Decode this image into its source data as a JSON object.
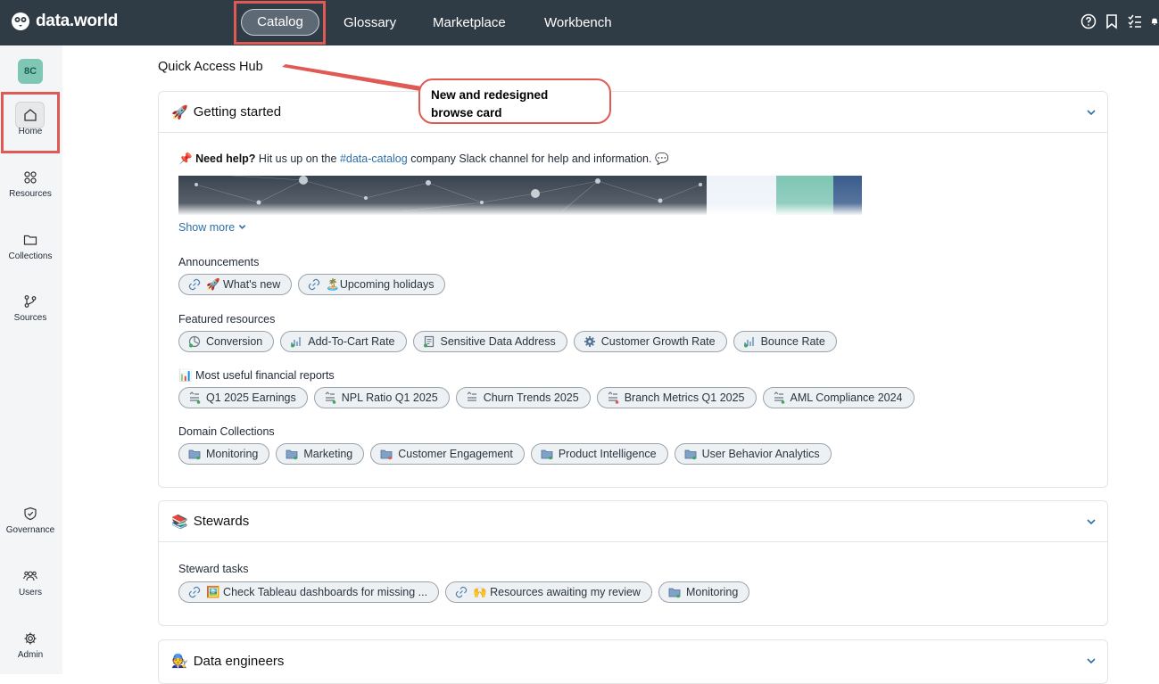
{
  "app": {
    "logo_text": "data.world"
  },
  "topnav": {
    "items": [
      "Catalog",
      "Glossary",
      "Marketplace",
      "Workbench"
    ],
    "active": "Catalog"
  },
  "sidebar": {
    "avatar": "8C",
    "items": [
      {
        "label": "Home",
        "icon": "home-icon"
      },
      {
        "label": "Resources",
        "icon": "resources-icon"
      },
      {
        "label": "Collections",
        "icon": "folder-icon"
      },
      {
        "label": "Sources",
        "icon": "branch-icon"
      },
      {
        "label": "Governance",
        "icon": "shield-icon"
      },
      {
        "label": "Users",
        "icon": "users-icon"
      },
      {
        "label": "Admin",
        "icon": "gear-icon"
      }
    ]
  },
  "main": {
    "hub_title": "Quick Access Hub",
    "callout": {
      "line1": "New and redesigned",
      "line2": "browse card"
    },
    "getting_started": {
      "emoji": "🚀",
      "title": "Getting started",
      "help_emoji": "📌",
      "help_bold": "Need help?",
      "help_pre": " Hit us up on the ",
      "help_link": "#data-catalog",
      "help_post": " company Slack channel for help and information. 💬",
      "show_more": "Show more",
      "announcements_label": "Announcements",
      "announcements": [
        "🚀 What's new",
        "🏝️Upcoming holidays"
      ],
      "featured_label": "Featured resources",
      "featured": [
        "Conversion",
        "Add-To-Cart Rate",
        "Sensitive Data Address",
        "Customer Growth Rate",
        "Bounce Rate"
      ],
      "reports_label": "📊 Most useful financial reports",
      "reports": [
        "Q1 2025 Earnings",
        "NPL Ratio Q1 2025",
        "Churn Trends 2025",
        "Branch Metrics Q1 2025",
        "AML Compliance 2024"
      ],
      "domains_label": "Domain Collections",
      "domains": [
        "Monitoring",
        "Marketing",
        "Customer Engagement",
        "Product Intelligence",
        "User Behavior Analytics"
      ]
    },
    "stewards": {
      "emoji": "📚",
      "title": "Stewards",
      "tasks_label": "Steward tasks",
      "tasks": [
        "🖼️ Check Tableau dashboards for missing ...",
        "🙌 Resources awaiting my review",
        "Monitoring"
      ]
    },
    "data_engineers": {
      "emoji": "🧑‍🔧",
      "title": "Data engineers"
    }
  },
  "colors": {
    "topbar": "#2f3b45",
    "accent_red": "#e05a55",
    "link": "#2e6fa6",
    "chip_bg": "#eef1f4"
  }
}
